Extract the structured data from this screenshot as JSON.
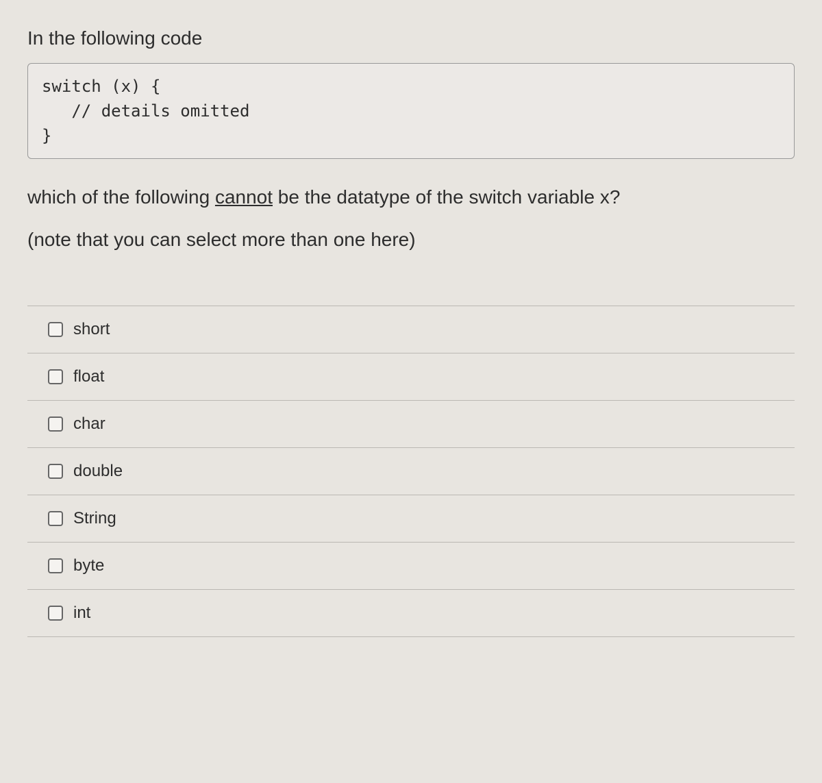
{
  "question": {
    "intro": "In the following code",
    "code": "switch (x) {\n   // details omitted\n}",
    "text_before": "which of the following ",
    "text_underlined": "cannot",
    "text_after": " be the datatype of the switch variable x?",
    "note": "(note that you can select more than one here)"
  },
  "options": [
    {
      "label": "short"
    },
    {
      "label": "float"
    },
    {
      "label": "char"
    },
    {
      "label": "double"
    },
    {
      "label": "String"
    },
    {
      "label": "byte"
    },
    {
      "label": "int"
    }
  ]
}
